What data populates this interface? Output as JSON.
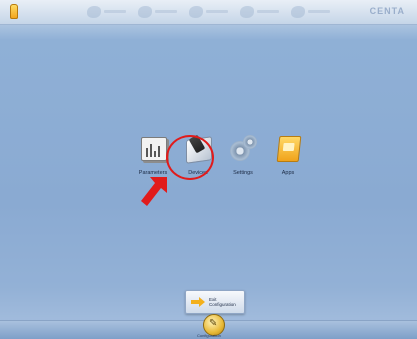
{
  "topbar": {
    "brand": "CENTA",
    "nav_items": [
      "nav-item-1",
      "nav-item-2",
      "nav-item-3",
      "nav-item-4",
      "nav-item-5"
    ]
  },
  "tiles": [
    {
      "label": "Parameters",
      "icon": "parameters-icon"
    },
    {
      "label": "Devices",
      "icon": "devices-icon"
    },
    {
      "label": "Settings",
      "icon": "settings-icon"
    },
    {
      "label": "Apps",
      "icon": "apps-icon"
    }
  ],
  "annotation": {
    "highlight_color": "#e11b1b",
    "target": "Devices"
  },
  "exit": {
    "line1": "Exit",
    "line2": "Configuration"
  },
  "bottom": {
    "config_label": "Configuration"
  },
  "colors": {
    "accent": "#f2a11a",
    "background": "#8aaad2"
  }
}
